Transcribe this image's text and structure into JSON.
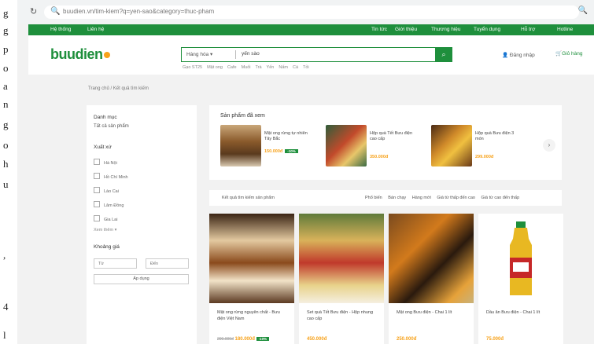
{
  "doc_strip": {
    "chars": [
      "g",
      "g",
      "p",
      "o",
      "a",
      "n",
      "g",
      "o",
      "h",
      "u",
      ",",
      "4",
      "l"
    ]
  },
  "browser": {
    "url": "buudien.vn/tim-kiem?q=yen-sao&category=thuc-pham"
  },
  "top_nav": {
    "items": [
      "Hệ thống",
      "Liên hệ",
      "Tin tức",
      "Giới thiệu",
      "Thương hiệu",
      "Tuyển dụng",
      "Hỗ trợ",
      "Hotline"
    ]
  },
  "header": {
    "logo": "buudien",
    "search": {
      "category": "Hàng hóa",
      "query": "yến sào"
    },
    "keywords": [
      "Gạo ST25",
      "Mật ong",
      "Cafe",
      "Muối",
      "Trà",
      "Yến",
      "Nấm",
      "Cá",
      "Tỏi"
    ],
    "login": "Đăng nhập",
    "cart": "Giỏ hàng"
  },
  "breadcrumb": "Trang chủ / Kết quả tìm kiếm",
  "sidebar": {
    "category_title": "Danh mục",
    "category_value": "Tất cả sản phẩm",
    "origin_title": "Xuất xứ",
    "origins": [
      "Hà Nội",
      "Hồ Chí Minh",
      "Lào Cai",
      "Lâm Đồng",
      "Gia Lai"
    ],
    "show_more": "Xem thêm",
    "price_title": "Khoảng giá",
    "price_from": "Từ",
    "price_to": "Đến",
    "apply": "Áp dụng"
  },
  "viewed": {
    "title": "Sản phẩm đã xem",
    "items": [
      {
        "name": "Mật ong rừng tự nhiên Tây Bắc",
        "price": "150.000đ",
        "badge": "-10%"
      },
      {
        "name": "Hộp quà Tết Bưu điện cao cấp",
        "price": "350.000đ",
        "badge": ""
      },
      {
        "name": "Hộp quà Bưu điện 3 món",
        "price": "299.000đ",
        "badge": ""
      }
    ]
  },
  "sort": {
    "label": "Kết quả tìm kiếm sản phẩm",
    "options": [
      "Phổ biến",
      "Bán chạy",
      "Hàng mới",
      "Giá từ thấp đến cao",
      "Giá từ cao đến thấp"
    ]
  },
  "products": [
    {
      "name": "Mật ong rừng nguyên chất - Bưu điện Việt Nam",
      "price": "180.000đ",
      "old_price": "200.000đ",
      "badge": "-10%"
    },
    {
      "name": "Set quà Tết Bưu điện - Hộp nhung cao cấp",
      "price": "450.000đ",
      "old_price": "",
      "badge": ""
    },
    {
      "name": "Mật ong Bưu điện - Chai 1 lít",
      "price": "250.000đ",
      "old_price": "",
      "badge": ""
    },
    {
      "name": "Dầu ăn Bưu điện - Chai 1 lít",
      "price": "75.000đ",
      "old_price": "",
      "badge": ""
    }
  ],
  "colors": {
    "brand_green": "#1e8f3c",
    "price_orange": "#f7a21b"
  }
}
